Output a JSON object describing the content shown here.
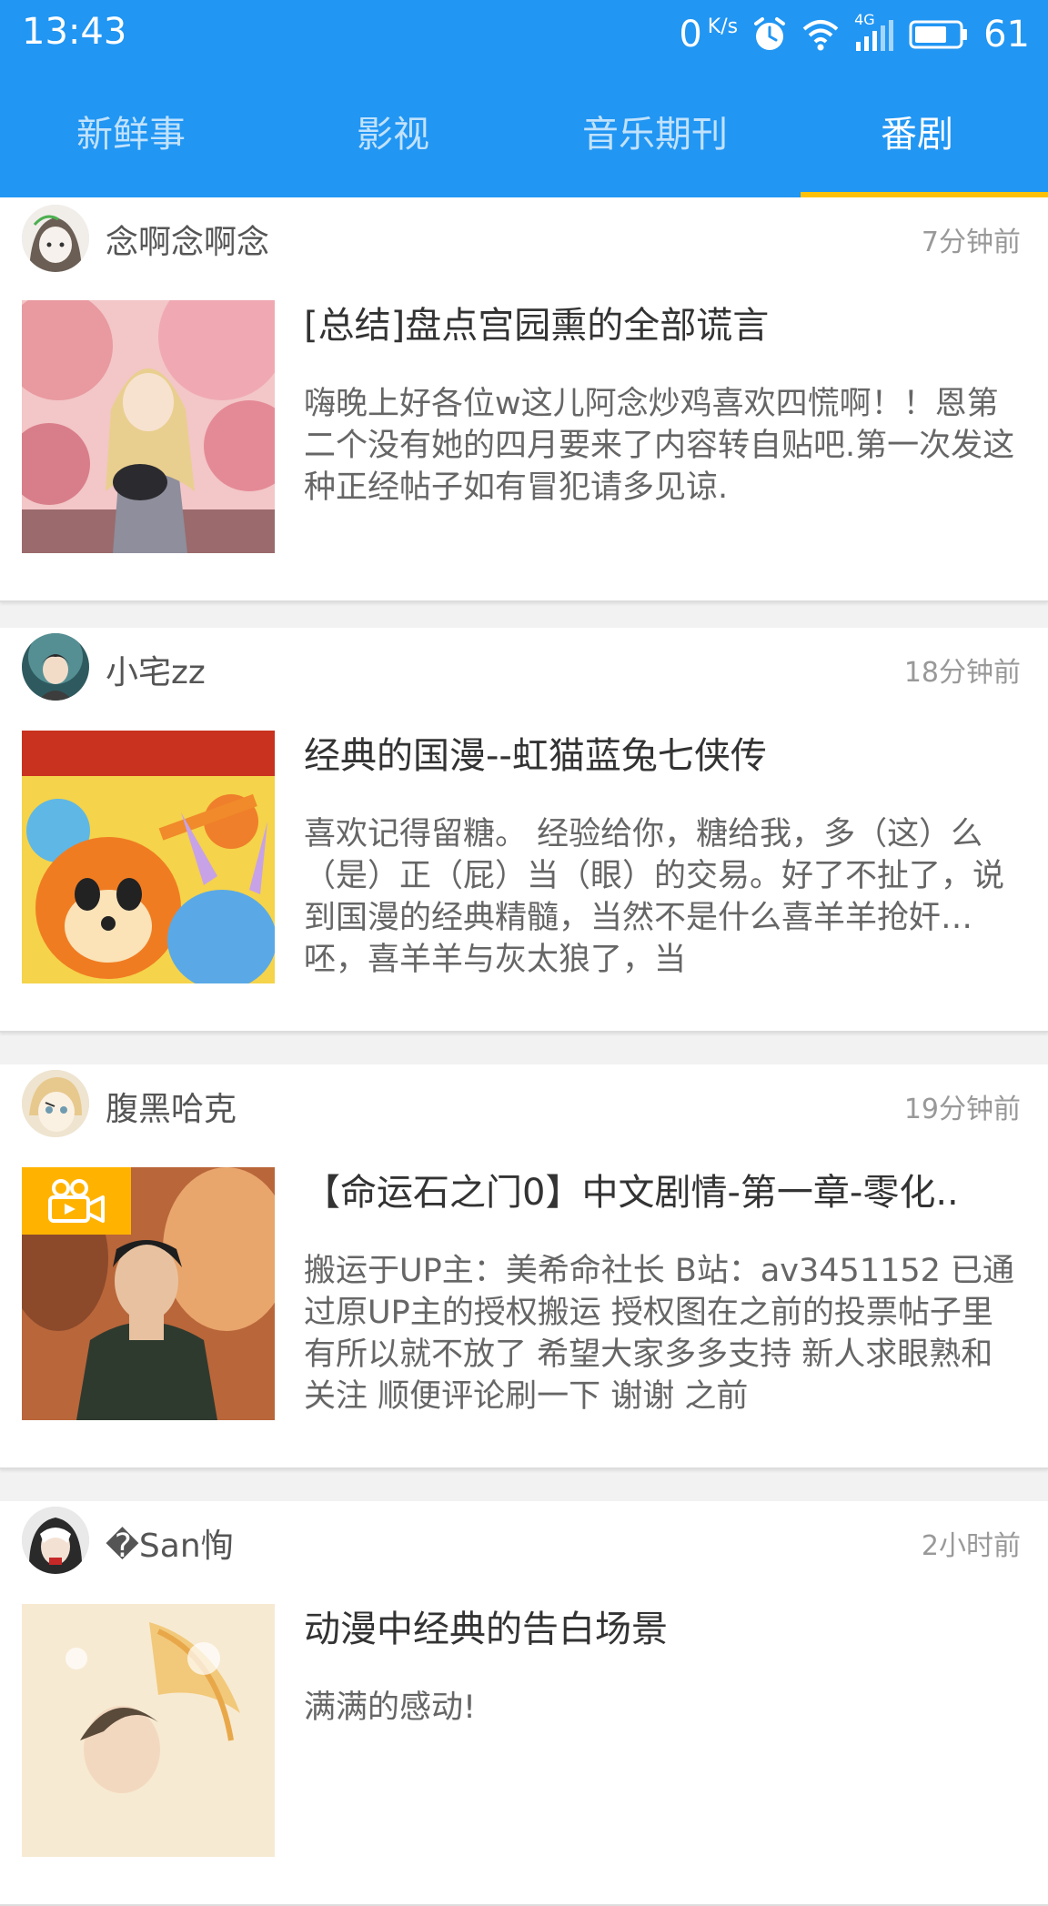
{
  "status_bar": {
    "time": "13:43",
    "net_speed": "0",
    "net_speed_unit": "K/s",
    "network_type": "4G",
    "battery_level": "61",
    "icons": [
      "alarm-icon",
      "wifi-icon",
      "signal-icon",
      "battery-icon"
    ]
  },
  "tabs": [
    {
      "label": "新鲜事",
      "active": false
    },
    {
      "label": "影视",
      "active": false
    },
    {
      "label": "音乐期刊",
      "active": false
    },
    {
      "label": "番剧",
      "active": true
    }
  ],
  "colors": {
    "app_bar": "#2196F3",
    "tab_indicator": "#FFC107",
    "video_badge": "#FFB300"
  },
  "posts": [
    {
      "username": "念啊念啊念",
      "time": "7分钟前",
      "title": "[总结]盘点宫园熏的全部谎言",
      "excerpt": "嗨晚上好各位w这儿阿念炒鸡喜欢四慌啊！！恩第二个没有她的四月要来了内容转自贴吧.第一次发这种正经帖子如有冒犯请多见谅.",
      "has_video_badge": false
    },
    {
      "username": "小宅zz",
      "time": "18分钟前",
      "title": "经典的国漫--虹猫蓝兔七侠传",
      "excerpt": "喜欢记得留糖。 经验给你，糖给我，多（这）么（是）正（屁）当（眼）的交易。好了不扯了，说到国漫的经典精髓，当然不是什么喜羊羊抢奸…呸，喜羊羊与灰太狼了，当",
      "has_video_badge": false
    },
    {
      "username": "腹黑哈克",
      "time": "19分钟前",
      "title": "【命运石之门0】中文剧情-第一章-零化..",
      "excerpt": "搬运于UP主：美希命社长 B站：av3451152 已通过原UP主的授权搬运 授权图在之前的投票帖子里有所以就不放了 希望大家多多支持 新人求眼熟和关注 顺便评论刷一下 谢谢 之前",
      "has_video_badge": true
    },
    {
      "username": "�San恂",
      "time": "2小时前",
      "title": "动漫中经典的告白场景",
      "excerpt": "满满的感动!",
      "has_video_badge": false
    }
  ]
}
